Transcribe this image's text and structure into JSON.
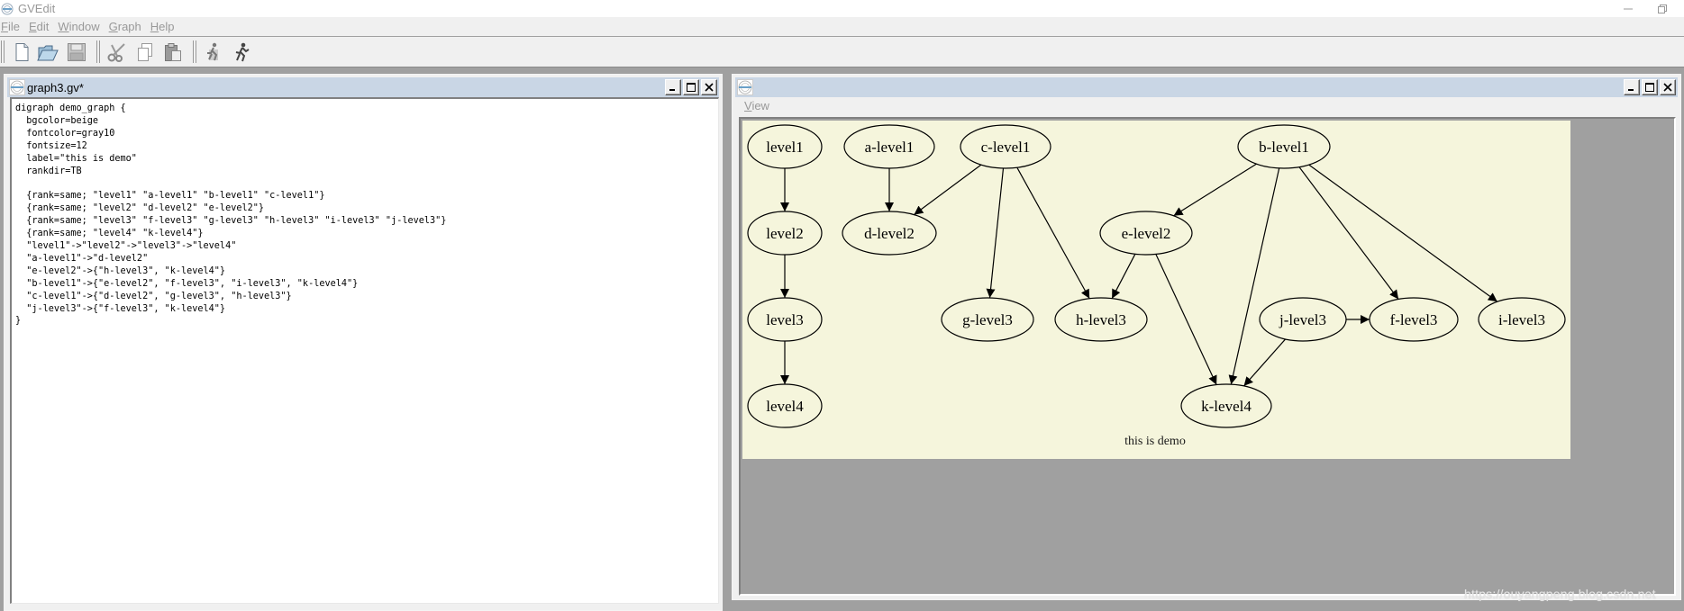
{
  "app": {
    "title": "GVEdit",
    "window_controls": [
      "minimize",
      "restore"
    ]
  },
  "menubar": {
    "items": [
      {
        "label": "File",
        "mnemonic": "F",
        "rest": "ile"
      },
      {
        "label": "Edit",
        "mnemonic": "E",
        "rest": "dit"
      },
      {
        "label": "Window",
        "mnemonic": "W",
        "rest": "indow"
      },
      {
        "label": "Graph",
        "mnemonic": "G",
        "rest": "raph"
      },
      {
        "label": "Help",
        "mnemonic": "H",
        "rest": "elp"
      }
    ]
  },
  "toolbar": {
    "buttons": [
      {
        "name": "new-file",
        "icon": "new-document-icon"
      },
      {
        "name": "open-file",
        "icon": "open-folder-icon"
      },
      {
        "name": "save-file",
        "icon": "save-icon"
      },
      {
        "name": "cut",
        "icon": "scissors-icon"
      },
      {
        "name": "copy",
        "icon": "copy-icon"
      },
      {
        "name": "paste",
        "icon": "paste-icon"
      },
      {
        "name": "settings-run",
        "icon": "run-settings-icon"
      },
      {
        "name": "run",
        "icon": "running-man-icon"
      }
    ]
  },
  "editor_window": {
    "title": "graph3.gv*",
    "content": "digraph demo_graph {\n  bgcolor=beige\n  fontcolor=gray10\n  fontsize=12\n  label=\"this is demo\"\n  rankdir=TB\n\n  {rank=same; \"level1\" \"a-level1\" \"b-level1\" \"c-level1\"}\n  {rank=same; \"level2\" \"d-level2\" \"e-level2\"}\n  {rank=same; \"level3\" \"f-level3\" \"g-level3\" \"h-level3\" \"i-level3\" \"j-level3\"}\n  {rank=same; \"level4\" \"k-level4\"}\n  \"level1\"->\"level2\"->\"level3\"->\"level4\"\n  \"a-level1\"->\"d-level2\"\n  \"e-level2\"->{\"h-level3\", \"k-level4\"}\n  \"b-level1\"->{\"e-level2\", \"f-level3\", \"i-level3\", \"k-level4\"}\n  \"c-level1\"->{\"d-level2\", \"g-level3\", \"h-level3\"}\n  \"j-level3\"->{\"f-level3\", \"k-level4\"}\n}"
  },
  "preview_window": {
    "title": "",
    "menu": {
      "label": "View",
      "mnemonic": "V",
      "rest": "iew"
    },
    "graph": {
      "bgcolor": "#f5f5dc",
      "label": "this is demo",
      "nodes": [
        {
          "id": "level1",
          "label": "level1",
          "rank": 1,
          "col": 0
        },
        {
          "id": "a-level1",
          "label": "a-level1",
          "rank": 1,
          "col": 1
        },
        {
          "id": "c-level1",
          "label": "c-level1",
          "rank": 1,
          "col": 2
        },
        {
          "id": "b-level1",
          "label": "b-level1",
          "rank": 1,
          "col": 3
        },
        {
          "id": "level2",
          "label": "level2",
          "rank": 2,
          "col": 0
        },
        {
          "id": "d-level2",
          "label": "d-level2",
          "rank": 2,
          "col": 1
        },
        {
          "id": "e-level2",
          "label": "e-level2",
          "rank": 2,
          "col": 2
        },
        {
          "id": "level3",
          "label": "level3",
          "rank": 3,
          "col": 0
        },
        {
          "id": "g-level3",
          "label": "g-level3",
          "rank": 3,
          "col": 1
        },
        {
          "id": "h-level3",
          "label": "h-level3",
          "rank": 3,
          "col": 2
        },
        {
          "id": "j-level3",
          "label": "j-level3",
          "rank": 3,
          "col": 3
        },
        {
          "id": "f-level3",
          "label": "f-level3",
          "rank": 3,
          "col": 4
        },
        {
          "id": "i-level3",
          "label": "i-level3",
          "rank": 3,
          "col": 5
        },
        {
          "id": "level4",
          "label": "level4",
          "rank": 4,
          "col": 0
        },
        {
          "id": "k-level4",
          "label": "k-level4",
          "rank": 4,
          "col": 1
        }
      ],
      "edges": [
        [
          "level1",
          "level2"
        ],
        [
          "level2",
          "level3"
        ],
        [
          "level3",
          "level4"
        ],
        [
          "a-level1",
          "d-level2"
        ],
        [
          "e-level2",
          "h-level3"
        ],
        [
          "e-level2",
          "k-level4"
        ],
        [
          "b-level1",
          "e-level2"
        ],
        [
          "b-level1",
          "f-level3"
        ],
        [
          "b-level1",
          "i-level3"
        ],
        [
          "b-level1",
          "k-level4"
        ],
        [
          "c-level1",
          "d-level2"
        ],
        [
          "c-level1",
          "g-level3"
        ],
        [
          "c-level1",
          "h-level3"
        ],
        [
          "j-level3",
          "f-level3"
        ],
        [
          "j-level3",
          "k-level4"
        ]
      ]
    }
  },
  "watermark": "https://ouyangpeng.blog.csdn.net"
}
